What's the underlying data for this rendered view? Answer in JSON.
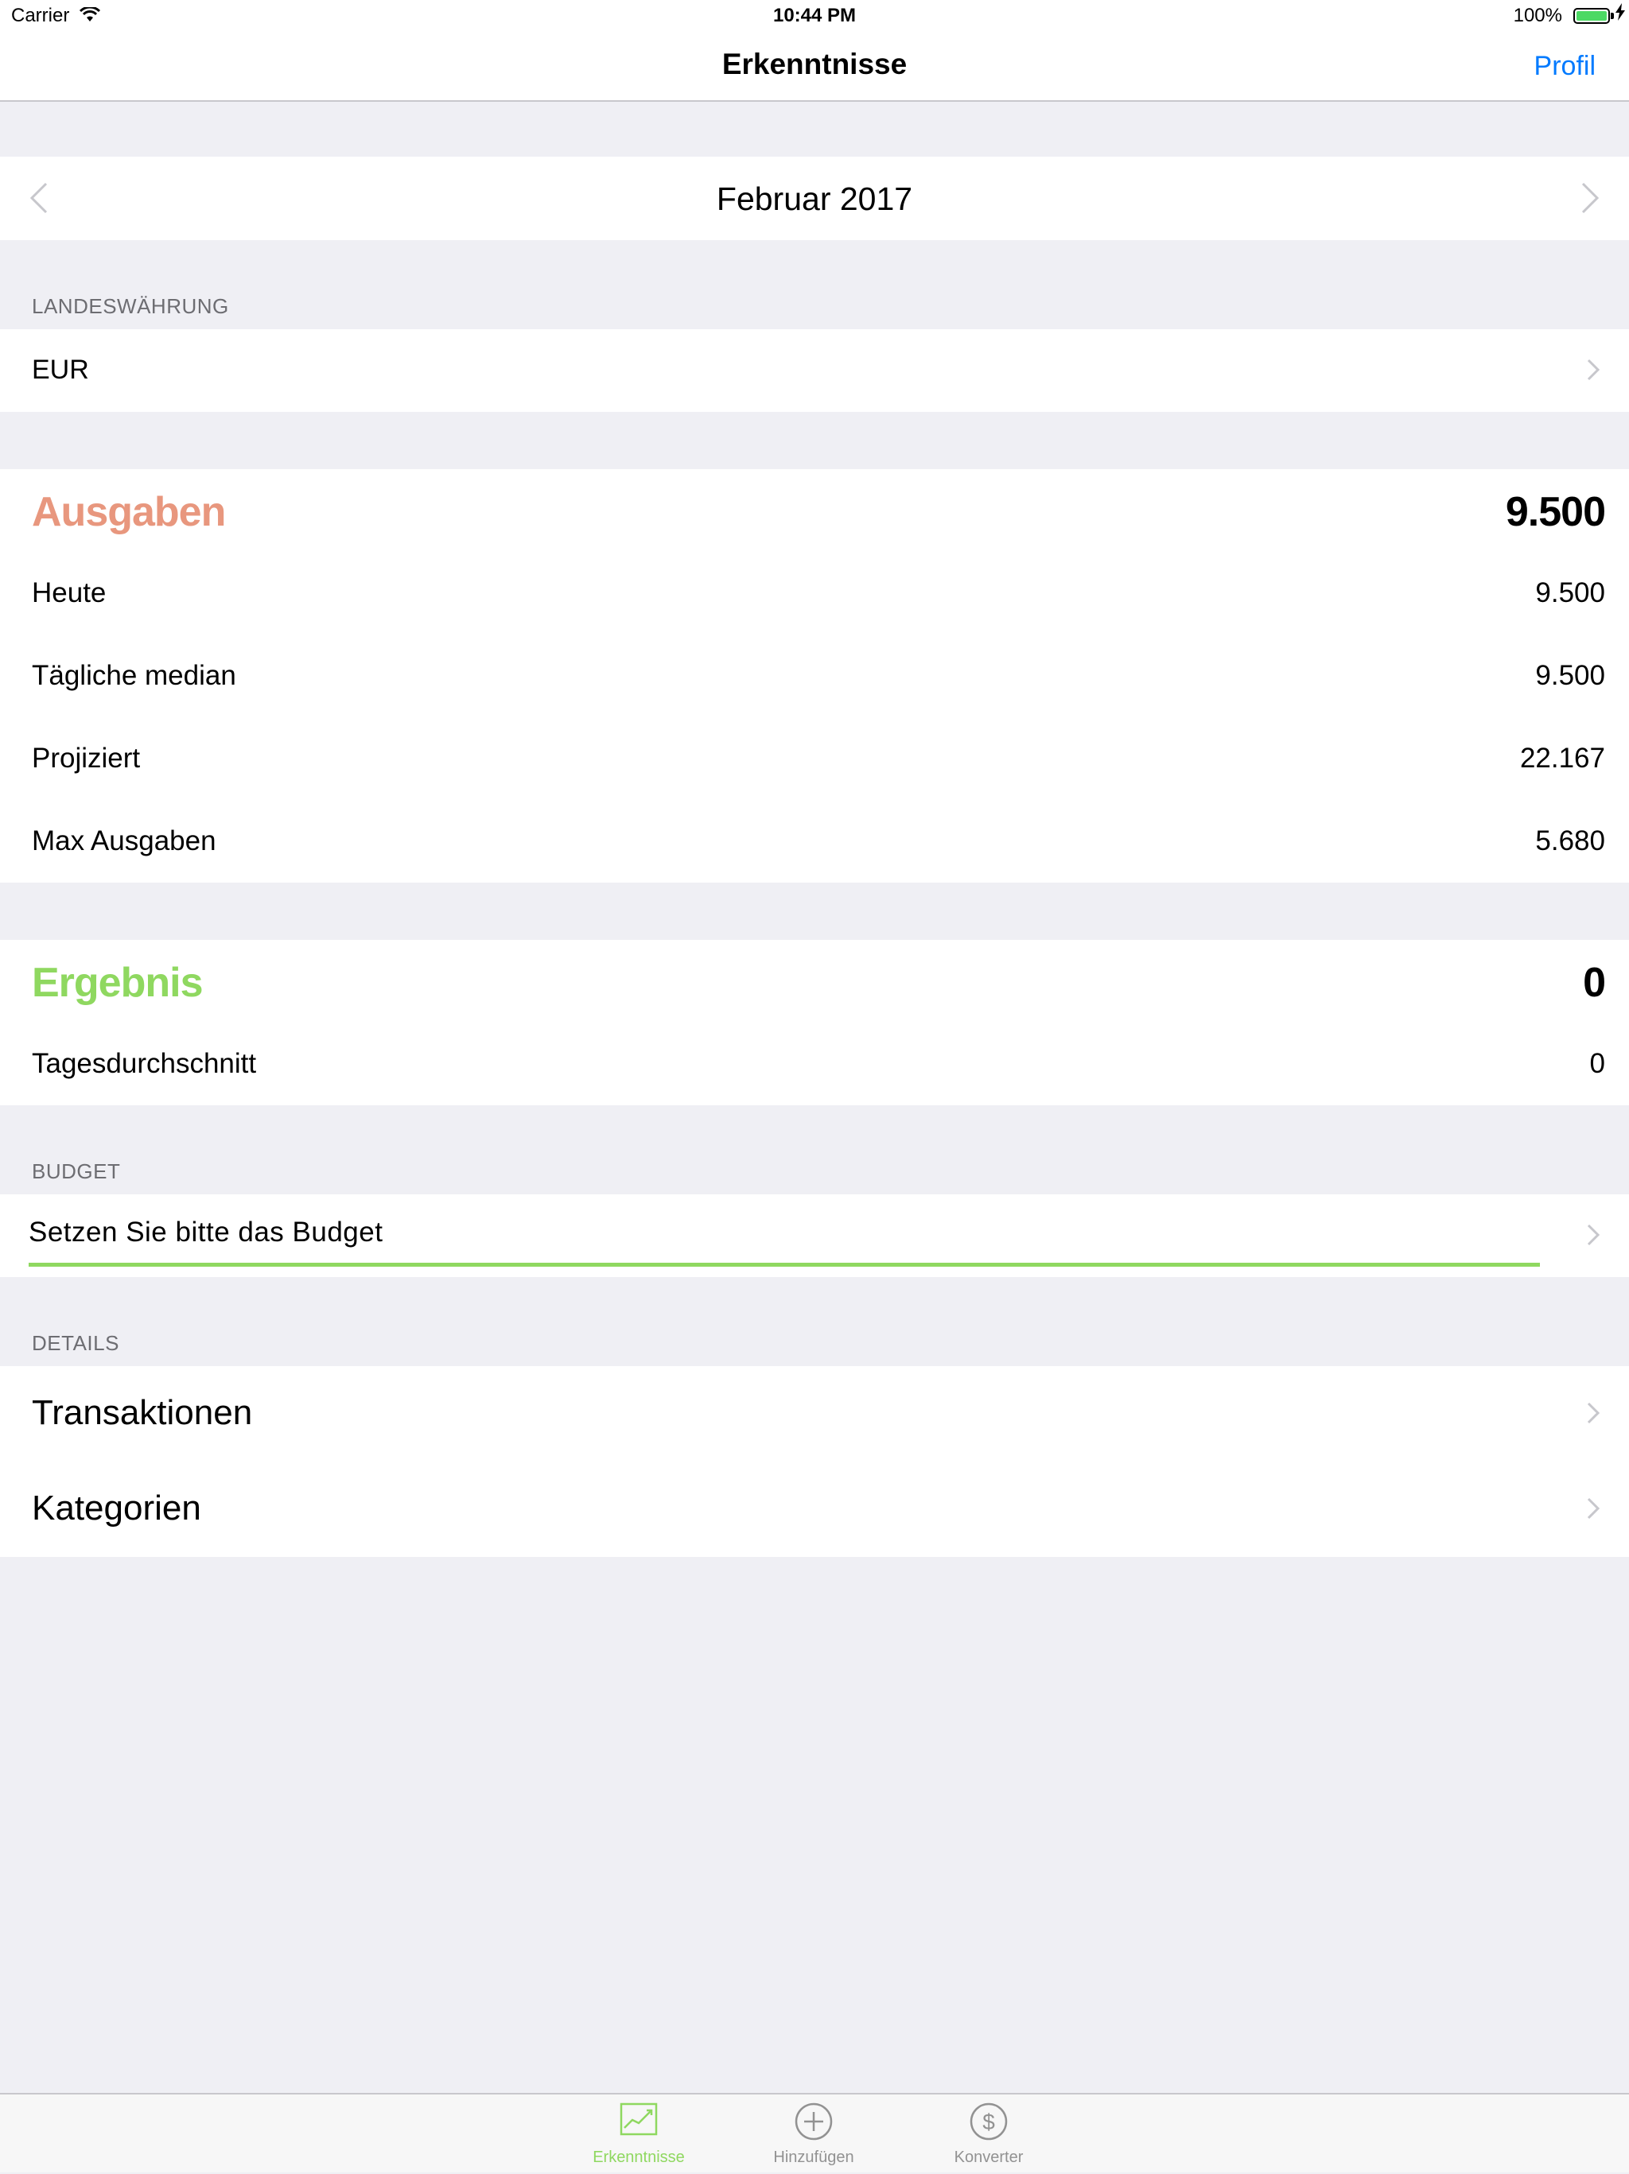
{
  "status_bar": {
    "carrier": "Carrier",
    "time": "10:44 PM",
    "battery": "100%"
  },
  "nav": {
    "title": "Erkenntnisse",
    "profile_label": "Profil"
  },
  "period": {
    "label": "Februar 2017"
  },
  "currency": {
    "header": "LANDESWÄHRUNG",
    "value": "EUR"
  },
  "expenses": {
    "title": "Ausgaben",
    "total": "9.500",
    "title_color": "#e8977e",
    "rows": [
      {
        "label": "Heute",
        "value": "9.500"
      },
      {
        "label": "Tägliche median",
        "value": "9.500"
      },
      {
        "label": "Projiziert",
        "value": "22.167"
      },
      {
        "label": "Max Ausgaben",
        "value": "5.680"
      }
    ]
  },
  "result": {
    "title": "Ergebnis",
    "total": "0",
    "title_color": "#8fd860",
    "rows": [
      {
        "label": "Tagesdurchschnitt",
        "value": "0"
      }
    ]
  },
  "budget": {
    "header": "BUDGET",
    "prompt": "Setzen Sie bitte das Budget"
  },
  "details": {
    "header": "DETAILS",
    "items": [
      {
        "label": "Transaktionen"
      },
      {
        "label": "Kategorien"
      }
    ]
  },
  "tabs": [
    {
      "label": "Erkenntnisse",
      "icon": "chart-icon",
      "active": true
    },
    {
      "label": "Hinzufügen",
      "icon": "plus-circle-icon",
      "active": false
    },
    {
      "label": "Konverter",
      "icon": "dollar-circle-icon",
      "active": false
    }
  ],
  "colors": {
    "tint": "#007aff",
    "active_tab": "#8fd860",
    "inactive_tab": "#929292"
  }
}
